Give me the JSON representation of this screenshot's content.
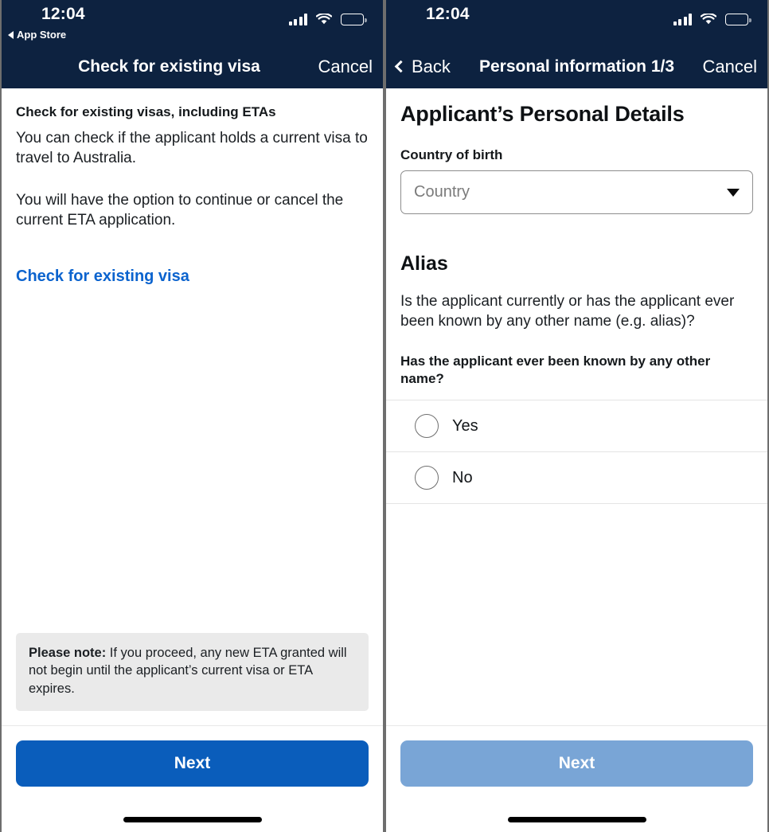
{
  "colors": {
    "navy": "#0d2240",
    "link_blue": "#0b63ce",
    "primary_button": "#0a5dbb",
    "disabled_button": "#79a5d6",
    "note_background": "#eaeaea"
  },
  "left_screen": {
    "status_bar": {
      "time": "12:04",
      "back_app_label": "App Store",
      "signal_icon": "cellular-signal-icon",
      "wifi_icon": "wifi-icon",
      "battery_icon": "battery-icon"
    },
    "nav": {
      "title": "Check for existing visa",
      "cancel_label": "Cancel"
    },
    "content": {
      "heading": "Check for existing visas, including ETAs",
      "paragraph_1": "You can check if the applicant holds a current visa to travel to Australia.",
      "paragraph_2": "You will have the option to continue or cancel the current ETA application.",
      "link_label": "Check for existing visa",
      "note_label": "Please note:",
      "note_text": " If you proceed, any new ETA granted will not begin until the applicant’s current visa or ETA expires."
    },
    "footer": {
      "next_label": "Next"
    }
  },
  "right_screen": {
    "status_bar": {
      "time": "12:04",
      "signal_icon": "cellular-signal-icon",
      "wifi_icon": "wifi-icon",
      "battery_icon": "battery-icon"
    },
    "nav": {
      "back_label": "Back",
      "title": "Personal information 1/3",
      "cancel_label": "Cancel"
    },
    "content": {
      "heading": "Applicant’s Personal Details",
      "country_label": "Country of birth",
      "country_placeholder": "Country",
      "alias_heading": "Alias",
      "alias_question": "Is the applicant currently or has the applicant ever been known by any other name (e.g. alias)?",
      "alias_prompt": "Has the applicant ever been known by any other name?",
      "options": [
        {
          "label": "Yes",
          "selected": false
        },
        {
          "label": "No",
          "selected": false
        }
      ]
    },
    "footer": {
      "next_label": "Next"
    }
  }
}
